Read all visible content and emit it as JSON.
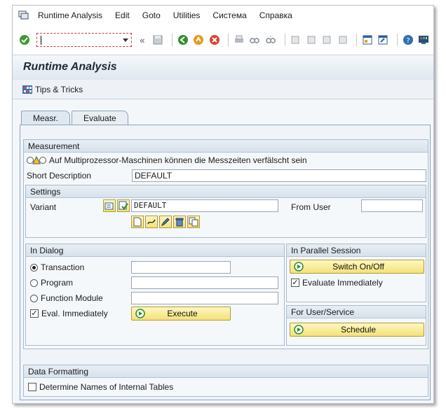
{
  "menubar": {
    "items": [
      {
        "label": "Runtime Analysis",
        "underline": "R"
      },
      {
        "label": "Edit",
        "underline": "E"
      },
      {
        "label": "Goto",
        "underline": "G"
      },
      {
        "label": "Utilities",
        "underline": "U"
      },
      {
        "label": "Система",
        "underline": "С"
      },
      {
        "label": "Справка",
        "underline": "С"
      }
    ]
  },
  "toolbar": {
    "command_value": "",
    "icons": [
      "enter-icon",
      "back-icon",
      "save-icon",
      "back-green-icon",
      "exit-icon",
      "cancel-icon",
      "print-icon",
      "find-icon",
      "find-next-icon",
      "first-page-icon",
      "prev-page-icon",
      "next-page-icon",
      "last-page-icon",
      "create-session-icon",
      "shortcut-icon",
      "help-icon",
      "layout-icon"
    ]
  },
  "header": {
    "title": "Runtime Analysis",
    "tips_label": "Tips & Tricks"
  },
  "tabs": [
    {
      "label": "Measr.",
      "active": true
    },
    {
      "label": "Evaluate",
      "active": false
    }
  ],
  "measurement": {
    "title": "Measurement",
    "warning": "Auf Multiprozessor-Maschinen können die Messzeiten verfälscht sein",
    "short_desc_label": "Short Description",
    "short_desc_value": "DEFAULT"
  },
  "settings": {
    "title": "Settings",
    "variant_label": "Variant",
    "variant_value": "DEFAULT",
    "from_user_label": "From User",
    "from_user_value": ""
  },
  "in_dialog": {
    "title": "In Dialog",
    "transaction_label": "Transaction",
    "program_label": "Program",
    "function_module_label": "Function Module",
    "eval_immediately_label": "Eval. Immediately",
    "execute_label": "Execute",
    "transaction_value": "",
    "program_value": "",
    "function_module_value": ""
  },
  "parallel_session": {
    "title": "In Parallel Session",
    "switch_label": "Switch On/Off",
    "evaluate_label": "Evaluate Immediately"
  },
  "user_service": {
    "title": "For User/Service",
    "schedule_label": "Schedule"
  },
  "data_formatting": {
    "title": "Data Formatting",
    "determine_names_label": "Determine Names of Internal Tables"
  },
  "colors": {
    "accent_button": "#f3e27a",
    "panel_border": "#8ba3bd",
    "enter_green": "#3a9a2a"
  }
}
